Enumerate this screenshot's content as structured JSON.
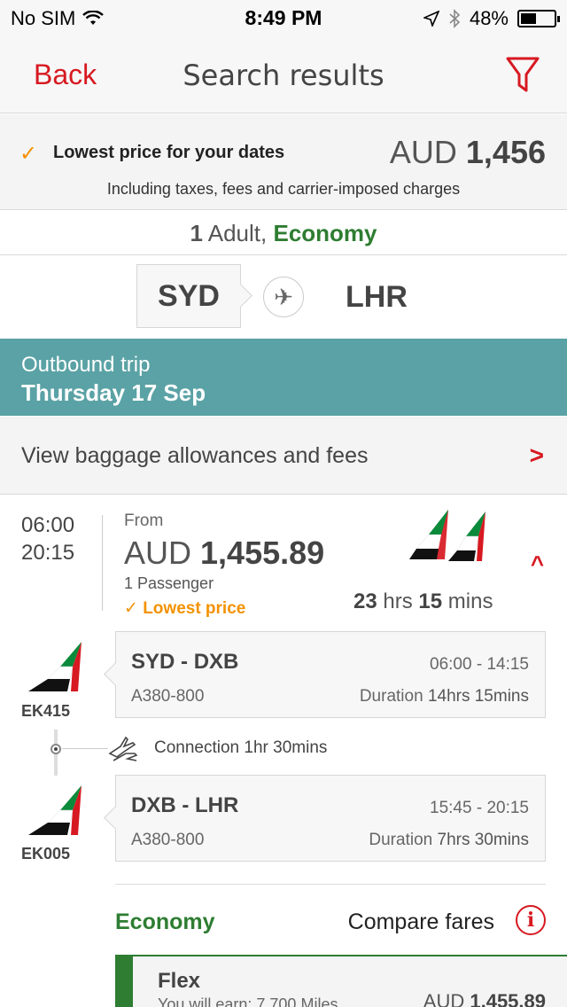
{
  "status_bar": {
    "carrier": "No SIM",
    "time": "8:49 PM",
    "battery": "48%",
    "battery_level": 0.48
  },
  "nav": {
    "back_label": "Back",
    "title": "Search results",
    "filter_icon": "filter-icon"
  },
  "price_banner": {
    "label": "Lowest price for your dates",
    "currency": "AUD",
    "amount": "1,456",
    "note": "Including taxes, fees and carrier-imposed charges"
  },
  "passengers": {
    "count": "1",
    "type": "Adult,",
    "cabin": "Economy"
  },
  "route": {
    "origin": "SYD",
    "destination": "LHR"
  },
  "outbound": {
    "label": "Outbound trip",
    "date": "Thursday 17 Sep"
  },
  "baggage": {
    "label": "View baggage allowances and fees"
  },
  "flight": {
    "depart": "06:00",
    "arrive": "20:15",
    "from_label": "From",
    "currency": "AUD",
    "amount": "1,455.89",
    "passengers": "1 Passenger",
    "lowest_label": "Lowest price",
    "duration_hrs": "23",
    "hrs_unit": "hrs",
    "duration_mins": "15",
    "mins_unit": "mins"
  },
  "segments": [
    {
      "code": "EK415",
      "route_from": "SYD",
      "route_to": "DXB",
      "times": "06:00 - 14:15",
      "aircraft": "A380-800",
      "duration_label": "Duration",
      "duration": "14hrs 15mins"
    },
    {
      "code": "EK005",
      "route_from": "DXB",
      "route_to": "LHR",
      "times": "15:45 - 20:15",
      "aircraft": "A380-800",
      "duration_label": "Duration",
      "duration": "7hrs 30mins"
    }
  ],
  "connection": {
    "label": "Connection 1hr 30mins"
  },
  "fares": {
    "cabin_label": "Economy",
    "compare_label": "Compare fares",
    "flex_name": "Flex",
    "flex_miles": "You will earn: 7,700 Miles",
    "flex_currency": "AUD",
    "flex_amount": "1,455.89"
  },
  "colors": {
    "accent_red": "#d71921",
    "economy_green": "#2e7d32",
    "teal_header": "#5aa2a5",
    "orange": "#f39200"
  }
}
